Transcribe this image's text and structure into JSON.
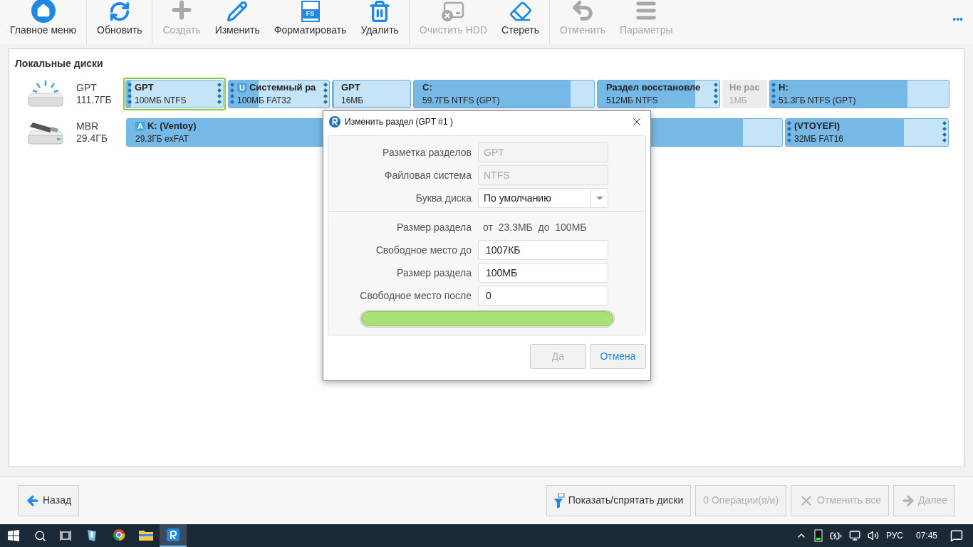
{
  "toolbar": {
    "groups": [
      [
        {
          "label": "Главное меню",
          "disabled": false
        }
      ],
      [
        {
          "label": "Обновить",
          "disabled": false
        }
      ],
      [
        {
          "label": "Создать",
          "disabled": true
        },
        {
          "label": "Изменить",
          "disabled": false
        },
        {
          "label": "Форматировать",
          "disabled": false,
          "icon_text": "FS"
        },
        {
          "label": "Удалить",
          "disabled": false
        }
      ],
      [
        {
          "label": "Очистить HDD",
          "disabled": true
        },
        {
          "label": "Стереть",
          "disabled": false
        }
      ],
      [
        {
          "label": "Отменить",
          "disabled": true
        },
        {
          "label": "Параметры",
          "disabled": true
        }
      ]
    ],
    "more": "•••"
  },
  "panel": {
    "title": "Локальные диски",
    "disks": [
      {
        "type": "GPT",
        "size": "111.7ГБ",
        "partitions": [
          {
            "kind": "partition",
            "name": "GPT",
            "info": "100МБ NTFS",
            "level": 0.05,
            "selected": true,
            "handle_left": true,
            "handle_right": true
          },
          {
            "kind": "partition",
            "name": "Системный ра",
            "info": "100МБ FAT32",
            "level": 0.3,
            "selected": false,
            "handle_left": true,
            "handle_right": true,
            "badge": "U"
          },
          {
            "kind": "partition",
            "name": "GPT",
            "info": "16МБ",
            "level": 0.02,
            "selected": false,
            "handle_left": false,
            "handle_right": false
          },
          {
            "kind": "partition",
            "name": "C:",
            "info": "59.7ГБ NTFS (GPT)",
            "level": 0.87,
            "selected": false,
            "handle_left": false,
            "handle_right": false
          },
          {
            "kind": "partition",
            "name": "Раздел восстановле",
            "info": "512МБ NTFS",
            "level": 0.8,
            "selected": false,
            "handle_left": false,
            "handle_right": true
          },
          {
            "kind": "unallocated",
            "name": "Не рас",
            "info": "1МБ"
          },
          {
            "kind": "partition",
            "name": "H:",
            "info": "51.3ГБ NTFS (GPT)",
            "level": 0.77,
            "selected": false,
            "handle_left": true,
            "handle_right": false
          }
        ]
      },
      {
        "type": "MBR",
        "size": "29.4ГБ",
        "partitions": [
          {
            "kind": "partition",
            "name": "K: (Ventoy)",
            "info": "29.3ГБ exFAT",
            "level": 0.94,
            "selected": false,
            "handle_left": false,
            "handle_right": false,
            "badge": "A"
          },
          {
            "kind": "partition",
            "name": "(VTOYEFI)",
            "info": "32МБ FAT16",
            "level": 0.73,
            "selected": false,
            "handle_left": true,
            "handle_right": true
          }
        ]
      }
    ]
  },
  "dialog": {
    "title": "Изменить раздел (GPT #1 )",
    "sections": [
      [
        {
          "label": "Разметка разделов",
          "kind": "readonly",
          "value": "GPT"
        },
        {
          "label": "Файловая система",
          "kind": "readonly",
          "value": "NTFS"
        },
        {
          "label": "Буква диска",
          "kind": "select",
          "value": "По умолчанию"
        }
      ],
      [
        {
          "label": "Размер раздела",
          "kind": "text",
          "value": "от  23.3МБ  до  100МБ"
        },
        {
          "label": "Свободное место до",
          "kind": "input",
          "value": "1007КБ"
        },
        {
          "label": "Размер раздела",
          "kind": "input",
          "value": "100МБ"
        },
        {
          "label": "Свободное место после",
          "kind": "input",
          "value": "0"
        }
      ]
    ],
    "size_bar": {
      "level": 1
    },
    "buttons": [
      {
        "label": "Да",
        "disabled": true
      },
      {
        "label": "Отмена",
        "disabled": false
      }
    ]
  },
  "footer": {
    "left": [
      {
        "label": "Назад",
        "disabled": false
      }
    ],
    "right": [
      {
        "label": "Показать/спрятать диски",
        "disabled": false
      },
      {
        "label": "0 Операции(я/и)",
        "disabled": true
      },
      {
        "label": "Отменить все",
        "disabled": true
      },
      {
        "label": "Далее",
        "disabled": true
      }
    ]
  },
  "taskbar": {
    "apps": [
      {
        "active": false
      },
      {
        "active": false
      },
      {
        "active": false
      },
      {
        "active": true
      }
    ],
    "language": "РУС",
    "time": "07:45"
  }
}
